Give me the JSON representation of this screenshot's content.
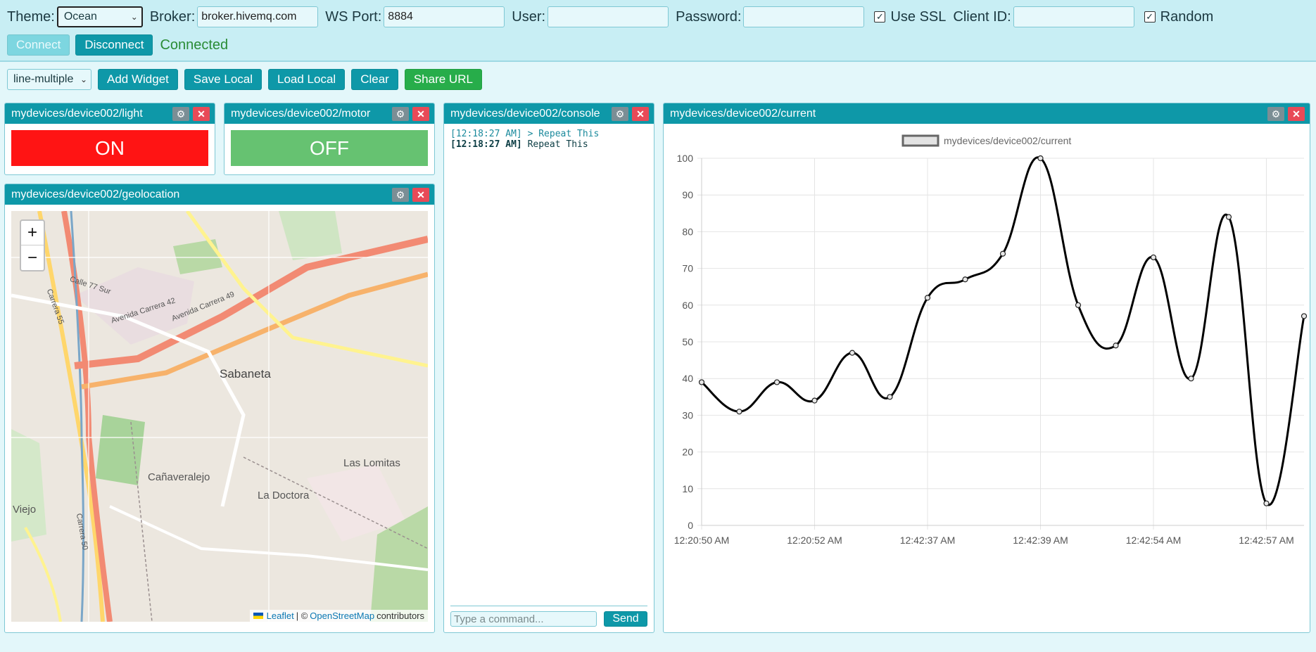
{
  "connection": {
    "theme_label": "Theme:",
    "theme_value": "Ocean",
    "broker_label": "Broker:",
    "broker_value": "broker.hivemq.com",
    "port_label": "WS Port:",
    "port_value": "8884",
    "user_label": "User:",
    "user_value": "",
    "password_label": "Password:",
    "password_value": "",
    "ssl_label": "Use SSL",
    "ssl_checked": true,
    "client_id_label": "Client ID:",
    "client_id_value": "",
    "random_label": "Random",
    "random_checked": true,
    "connect_label": "Connect",
    "disconnect_label": "Disconnect",
    "status": "Connected"
  },
  "toolbar": {
    "widget_type": "line-multiple",
    "add_widget": "Add Widget",
    "save_local": "Save Local",
    "load_local": "Load Local",
    "clear": "Clear",
    "share_url": "Share URL"
  },
  "widgets": {
    "light": {
      "title": "mydevices/device002/light",
      "state": "ON",
      "color": "#ff1414"
    },
    "motor": {
      "title": "mydevices/device002/motor",
      "state": "OFF",
      "color": "#66c271"
    },
    "geolocation": {
      "title": "mydevices/device002/geolocation",
      "zoom_in": "+",
      "zoom_out": "−",
      "labels": [
        "Sabaneta",
        "Las Lomitas",
        "Cañaveralejo",
        "La Doctora",
        "Viejo",
        "Avenida Carrera 42",
        "Avenida Carrera 49",
        "Calle 77 Sur",
        "Carrera 55",
        "Carrera 50"
      ],
      "attribution": {
        "leaflet": "Leaflet",
        "sep": "| ©",
        "osm": "OpenStreetMap",
        "contrib": "contributors"
      }
    },
    "console": {
      "title": "mydevices/device002/console",
      "lines": [
        {
          "time": "[12:18:27 AM]",
          "text": "> Repeat This"
        },
        {
          "time": "[12:18:27 AM]",
          "text": "Repeat This"
        }
      ],
      "input_placeholder": "Type a command...",
      "send_label": "Send"
    },
    "current": {
      "title": "mydevices/device002/current"
    }
  },
  "chart_data": {
    "type": "line",
    "series": [
      {
        "name": "mydevices/device002/current",
        "values": [
          39,
          31,
          39,
          34,
          47,
          35,
          62,
          67,
          74,
          100,
          60,
          49,
          73,
          40,
          84,
          6,
          57
        ]
      }
    ],
    "xticks": [
      "12:20:50 AM",
      "12:20:52 AM",
      "12:42:37 AM",
      "12:42:39 AM",
      "12:42:54 AM",
      "12:42:57 AM"
    ],
    "ylim": [
      0,
      100
    ],
    "yticks": [
      0,
      10,
      20,
      30,
      40,
      50,
      60,
      70,
      80,
      90,
      100
    ],
    "legend": "top",
    "grid": true,
    "line_color": "#000000"
  }
}
